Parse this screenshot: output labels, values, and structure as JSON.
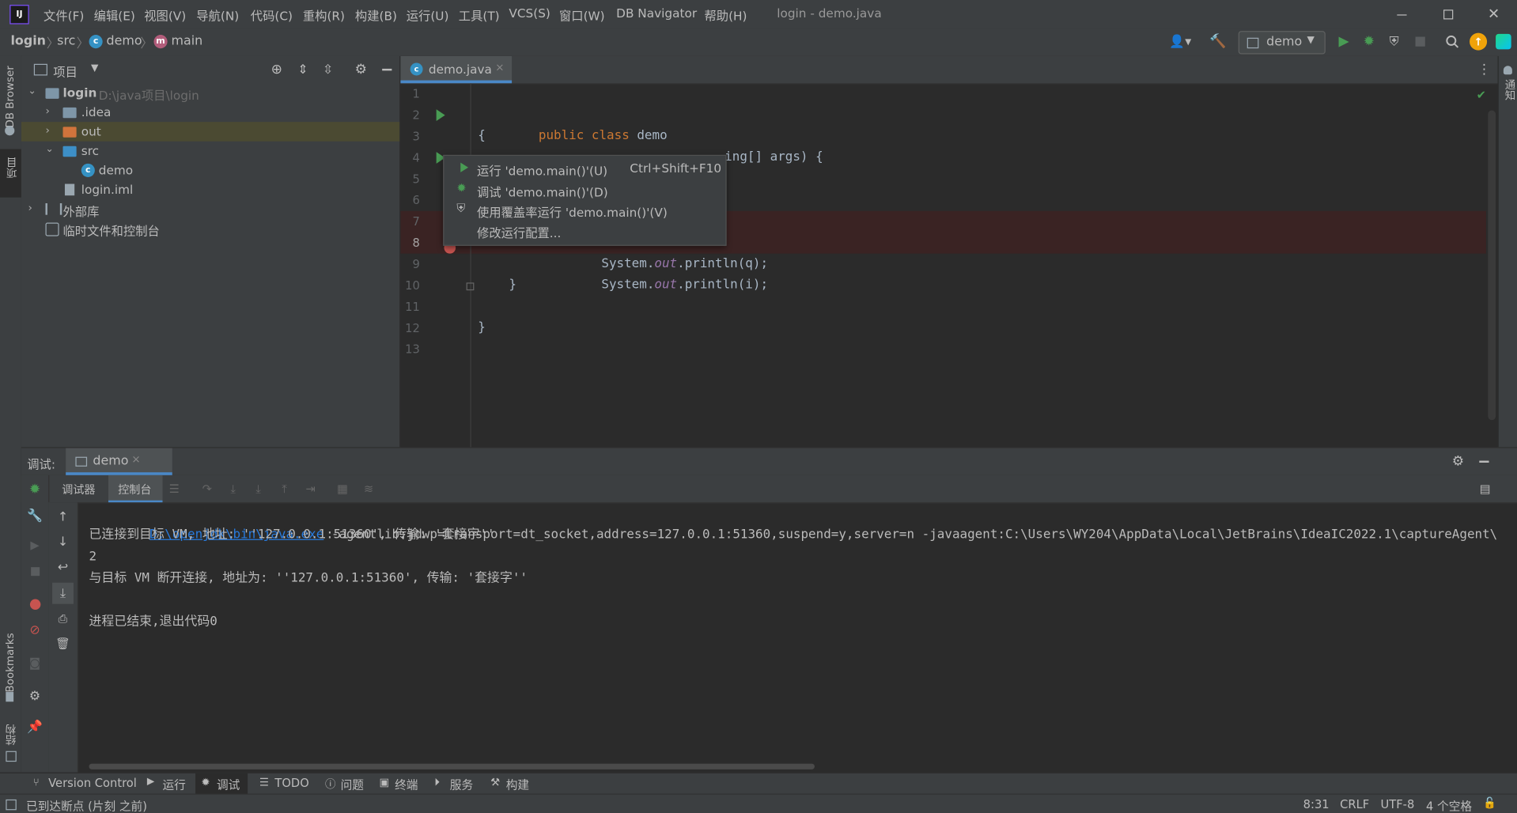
{
  "window": {
    "title": "login - demo.java"
  },
  "menu": [
    "文件(F)",
    "编辑(E)",
    "视图(V)",
    "导航(N)",
    "代码(C)",
    "重构(R)",
    "构建(B)",
    "运行(U)",
    "工具(T)",
    "VCS(S)",
    "窗口(W)",
    "DB Navigator",
    "帮助(H)"
  ],
  "breadcrumb": {
    "root": "login",
    "src": "src",
    "cls": "demo",
    "method": "main"
  },
  "run_config": "demo",
  "left_strip": {
    "db_browser": "DB Browser",
    "project": "项目",
    "bookmarks": "Bookmarks",
    "structure": "结构"
  },
  "project_panel": {
    "title": "项目",
    "tree": [
      {
        "name": "login",
        "hint": "D:\\java项目\\login"
      },
      {
        "name": ".idea"
      },
      {
        "name": "out"
      },
      {
        "name": "src"
      },
      {
        "name": "demo"
      },
      {
        "name": "login.iml"
      },
      {
        "name": "外部库"
      },
      {
        "name": "临时文件和控制台"
      }
    ]
  },
  "editor": {
    "tab": "demo.java",
    "line_numbers": [
      "1",
      "2",
      "3",
      "4",
      "5",
      "6",
      "7",
      "8",
      "9",
      "10",
      "11",
      "12",
      "13"
    ],
    "code": {
      "l2_kw1": "public",
      "l2_kw2": "class",
      "l2_name": "demo",
      "l3": "{",
      "l4_tail": "ing[] args) {",
      "l8_a": "System.",
      "l8_b": "out",
      "l8_c": ".println(q);",
      "l9_a": "System.",
      "l9_b": "out",
      "l9_c": ".println(i);",
      "l10": "}",
      "l12": "}"
    }
  },
  "popup": {
    "items": [
      {
        "label": "运行 'demo.main()'(U)",
        "shortcut": "Ctrl+Shift+F10"
      },
      {
        "label": "调试 'demo.main()'(D)"
      },
      {
        "label": "使用覆盖率运行 'demo.main()'(V)"
      },
      {
        "label": "修改运行配置..."
      }
    ]
  },
  "right_strip": {
    "notifications": "通知"
  },
  "debug": {
    "label": "调试:",
    "session": "demo",
    "tabs": {
      "debugger": "调试器",
      "console": "控制台"
    },
    "console": {
      "link": "D:\\openjdk\\bin\\java.exe",
      "line1_rest": " -agentlib:jdwp=transport=dt_socket,address=127.0.0.1:51360,suspend=y,server=n -javaagent:C:\\Users\\WY204\\AppData\\Local\\JetBrains\\IdeaIC2022.1\\captureAgent\\",
      "line2": "已连接到目标 VM, 地址: ''127.0.0.1:51360', 传输: '套接字''",
      "line3": "2",
      "line4": "与目标 VM 断开连接, 地址为: ''127.0.0.1:51360', 传输: '套接字''",
      "line5": "",
      "line6": "进程已结束,退出代码0"
    }
  },
  "bottom_tools": [
    "Version Control",
    "运行",
    "调试",
    "TODO",
    "问题",
    "终端",
    "服务",
    "构建"
  ],
  "status": {
    "message": "已到达断点 (片刻 之前)",
    "position": "8:31",
    "line_sep": "CRLF",
    "encoding": "UTF-8",
    "indent": "4 个空格"
  },
  "colors": {
    "accent": "#4a88c7",
    "breakpoint": "#c75450",
    "run": "#499c54",
    "keyword": "#cc7832",
    "field": "#9876aa",
    "breakpoint_line": "#3a2323"
  }
}
